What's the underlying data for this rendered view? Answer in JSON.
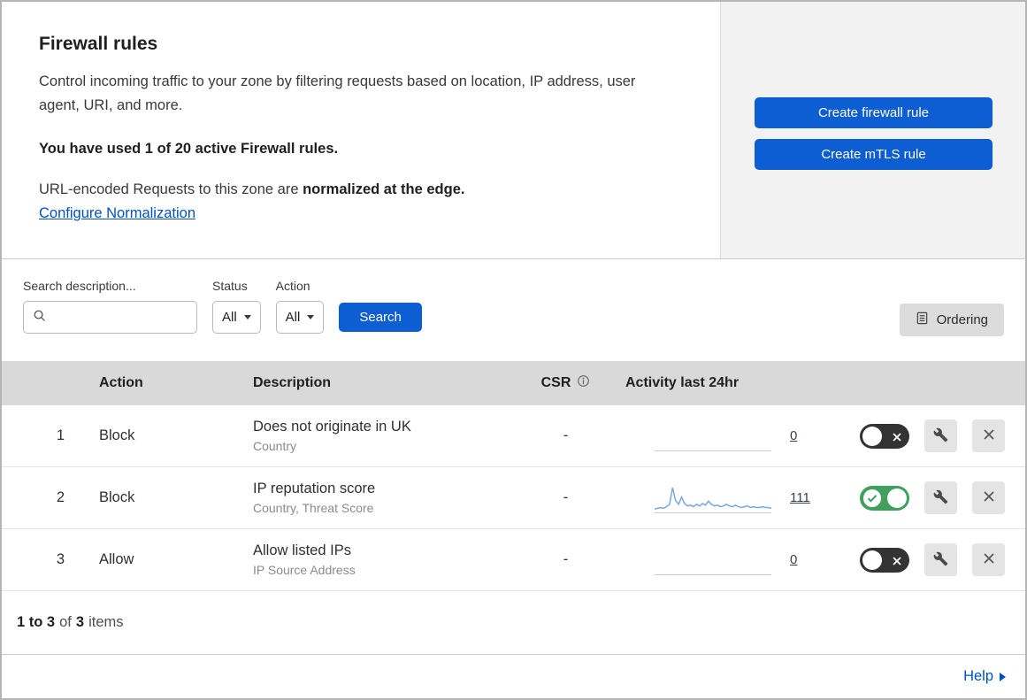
{
  "colors": {
    "accent_blue": "#0d5dd3",
    "link_blue": "#0051c3",
    "toggle_on_green": "#41a060",
    "toggle_off_gray": "#333333",
    "sparkline_blue": "#7aa7e0"
  },
  "header": {
    "title": "Firewall rules",
    "description": "Control incoming traffic to your zone by filtering requests based on location, IP address, user agent, URI, and more.",
    "usage_note": "You have used 1 of 20 active Firewall rules.",
    "normalization_text": "URL-encoded Requests to this zone are ",
    "normalization_bold": "normalized at the edge.",
    "normalization_link": "Configure Normalization",
    "create_firewall_rule_button": "Create firewall rule",
    "create_mtls_rule_button": "Create mTLS rule"
  },
  "filters": {
    "search_label": "Search description...",
    "status_label": "Status",
    "status_value": "All",
    "action_label": "Action",
    "action_value": "All",
    "search_button": "Search",
    "ordering_button": "Ordering"
  },
  "table": {
    "headers": {
      "action": "Action",
      "description": "Description",
      "csr": "CSR",
      "activity": "Activity last 24hr"
    },
    "rows": [
      {
        "priority": "1",
        "action": "Block",
        "description": "Does not originate in UK",
        "fields": "Country",
        "csr": "-",
        "activity_count": "0",
        "enabled": false
      },
      {
        "priority": "2",
        "action": "Block",
        "description": "IP reputation score",
        "fields": "Country, Threat Score",
        "csr": "-",
        "activity_count": "111",
        "enabled": true
      },
      {
        "priority": "3",
        "action": "Allow",
        "description": "Allow listed IPs",
        "fields": "IP Source Address",
        "csr": "-",
        "activity_count": "0",
        "enabled": false
      }
    ],
    "footer": {
      "range": "1 to 3",
      "of_text": "of",
      "total": "3",
      "items_text": "items"
    }
  },
  "help_link": "Help",
  "activity_sparkline": {
    "row_index": 1,
    "values": [
      3,
      4,
      5,
      4,
      6,
      9,
      30,
      14,
      9,
      18,
      10,
      7,
      8,
      6,
      9,
      7,
      10,
      8,
      13,
      9,
      7,
      8,
      6,
      7,
      9,
      7,
      6,
      8,
      6,
      5,
      6,
      7,
      5,
      6,
      5,
      5,
      6,
      5,
      5,
      4
    ],
    "color": "#7aa7e0"
  }
}
